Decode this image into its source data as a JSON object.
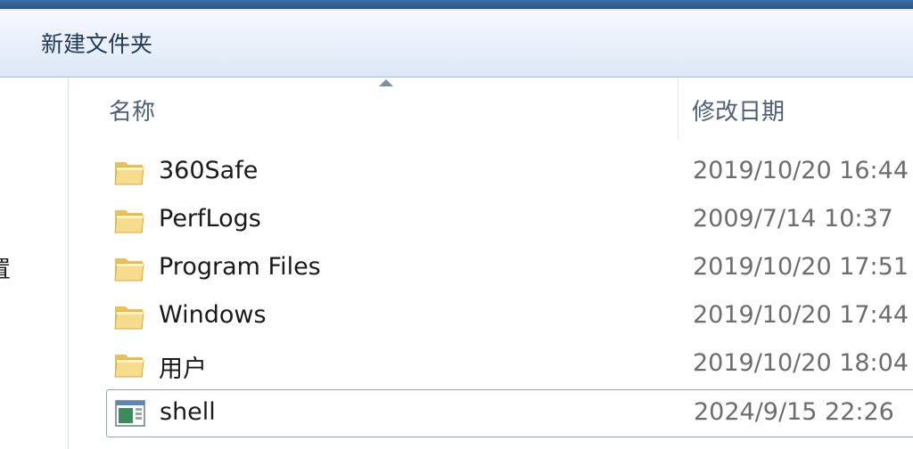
{
  "toolbar": {
    "new_folder_label": "新建文件夹"
  },
  "nav": {
    "partial_label": "置"
  },
  "columns": {
    "name": "名称",
    "date_modified": "修改日期"
  },
  "files": [
    {
      "name": "360Safe",
      "date": "2019/10/20 16:44",
      "type": "folder-icon"
    },
    {
      "name": "PerfLogs",
      "date": "2009/7/14 10:37",
      "type": "folder-icon"
    },
    {
      "name": "Program Files",
      "date": "2019/10/20 17:51",
      "type": "folder-icon"
    },
    {
      "name": "Windows",
      "date": "2019/10/20 17:44",
      "type": "folder-icon"
    },
    {
      "name": "用户",
      "date": "2019/10/20 18:04",
      "type": "folder-icon"
    },
    {
      "name": "shell",
      "date": "2024/9/15 22:26",
      "type": "application-icon",
      "selected": true
    }
  ],
  "colors": {
    "toolbar_text": "#1e395b",
    "header_text": "#4c607a",
    "date_text": "#6d6d6d",
    "selection_border": "#8fa7c4"
  }
}
